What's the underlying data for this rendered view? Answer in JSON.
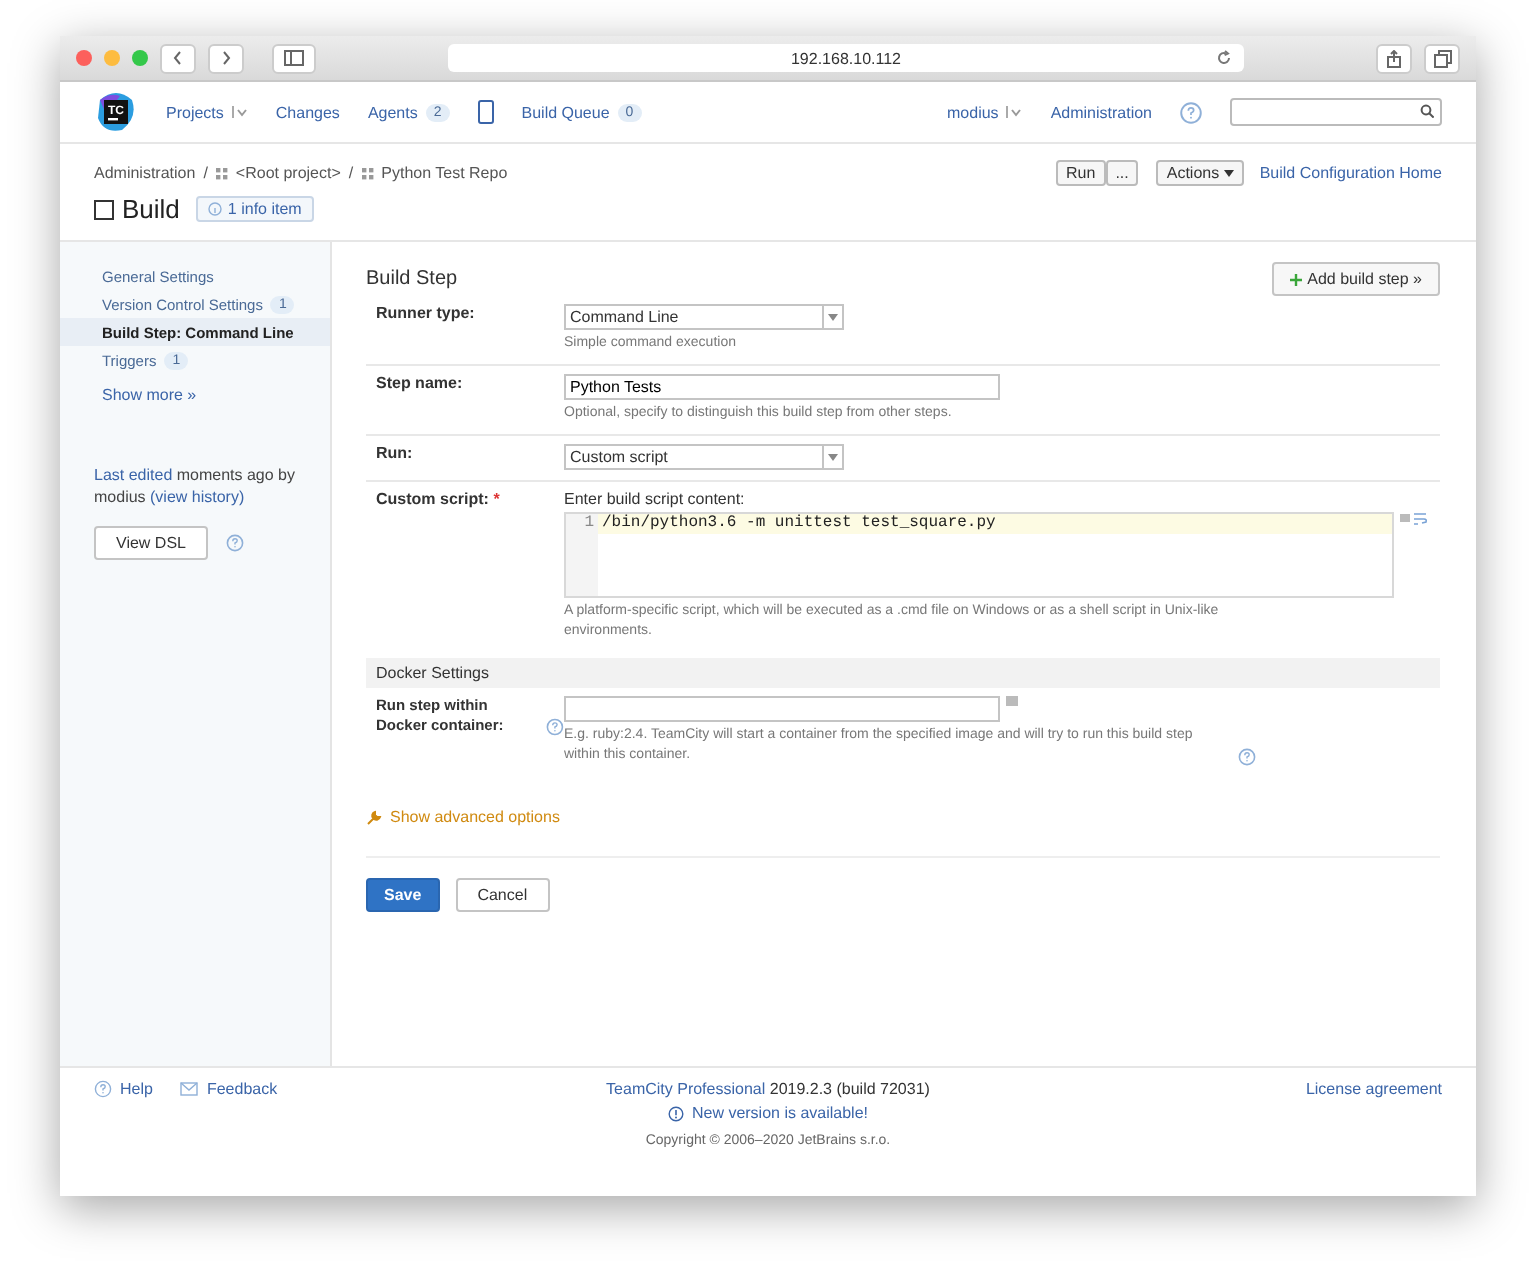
{
  "browser": {
    "url": "192.168.10.112"
  },
  "logo_text": "TC",
  "nav": {
    "items": [
      {
        "kind": "menu",
        "label": "Projects"
      },
      {
        "kind": "link",
        "label": "Changes"
      },
      {
        "kind": "link",
        "label": "Agents",
        "count": "2"
      },
      {
        "kind": "link",
        "label": "Build Queue",
        "count": "0"
      }
    ],
    "user": "modius",
    "administration": "Administration"
  },
  "breadcrumbs": [
    {
      "label": "Administration"
    },
    {
      "separator": "/",
      "label": "<Root project>"
    },
    {
      "separator": "/",
      "label": "Python Test Repo"
    }
  ],
  "actions": {
    "run": "Run",
    "run_more": "...",
    "actions": "Actions",
    "home": "Build Configuration Home"
  },
  "page_title": "Build",
  "info_badge": "1 info item",
  "sidebar": {
    "items": [
      {
        "label": "General Settings",
        "selected": false
      },
      {
        "label": "Version Control Settings",
        "count": "1",
        "selected": false
      },
      {
        "label": "Build Step: Command Line",
        "selected": true
      },
      {
        "label": "Triggers",
        "count": "1",
        "selected": false
      }
    ],
    "show_more": "Show more »",
    "last_edited": "Last edited",
    "edited_text": "moments ago by modius",
    "history": "(view history)",
    "view_dsl": "View DSL"
  },
  "form": {
    "title": "Build Step",
    "add_button": "Add build step »",
    "rows": [
      {
        "kind": "select",
        "label": "Runner type:",
        "value": "Command Line",
        "hint": "Simple command execution"
      },
      {
        "kind": "text",
        "label": "Step name:",
        "value": "Python Tests",
        "hint": "Optional, specify to distinguish this build step from other steps."
      },
      {
        "kind": "select",
        "label": "Run:",
        "value": "Custom script"
      },
      {
        "kind": "script",
        "label": "Custom script:",
        "required": "*",
        "intro": "Enter build script content:",
        "line": "1",
        "code": "/bin/python3.6 -m unittest test_square.py",
        "hint": "A platform-specific script, which will be executed as a .cmd file on Windows or as a shell script in Unix-like environments."
      }
    ],
    "section": "Docker Settings",
    "docker": {
      "label": "Run step within Docker container:",
      "hint": "E.g. ruby:2.4. TeamCity will start a container from the specified image and will try to run this build step within this container."
    },
    "advanced": "Show advanced options",
    "save": "Save",
    "cancel": "Cancel"
  },
  "footer": {
    "help": "Help",
    "feedback": "Feedback",
    "product": "TeamCity Professional",
    "version": "2019.2.3 (build 72031)",
    "update": "New version is available!",
    "copyright": "Copyright © 2006–2020 JetBrains s.r.o.",
    "license": "License agreement"
  }
}
